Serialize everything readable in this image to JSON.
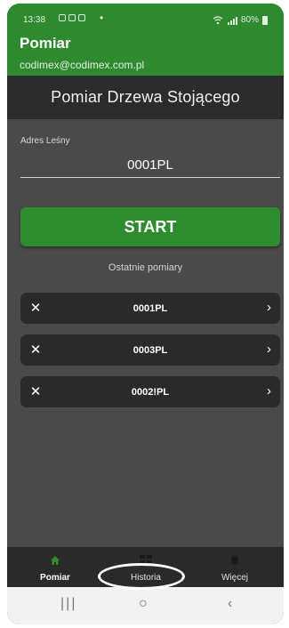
{
  "status_bar": {
    "time": "13:38",
    "dot": "•",
    "right_text": "80%"
  },
  "header": {
    "title": "Pomiar",
    "subtitle": "codimex@codimex.com.pl"
  },
  "page_title": "Pomiar Drzewa Stojącego",
  "form": {
    "label": "Adres Leśny",
    "value": "0001PL"
  },
  "start_label": "START",
  "recent_heading": "Ostatnie pomiary",
  "recent": [
    {
      "code": "0001PL",
      "remove_icon": "close-icon",
      "open_icon": "chevron-right-icon"
    },
    {
      "code": "0003PL",
      "remove_icon": "close-icon",
      "open_icon": "chevron-right-icon"
    },
    {
      "code": "0002!PL",
      "remove_icon": "close-icon",
      "open_icon": "chevron-right-icon"
    }
  ],
  "nav": [
    {
      "label": "Pomiar",
      "icon": "home-icon",
      "active": true
    },
    {
      "label": "Historia",
      "icon": "grid-icon",
      "active": false
    },
    {
      "label": "Więcej",
      "icon": "bell-icon",
      "active": false
    }
  ],
  "colors": {
    "accent": "#2e8b2e",
    "background": "#4a4a4a",
    "band": "#2b2b2b"
  }
}
